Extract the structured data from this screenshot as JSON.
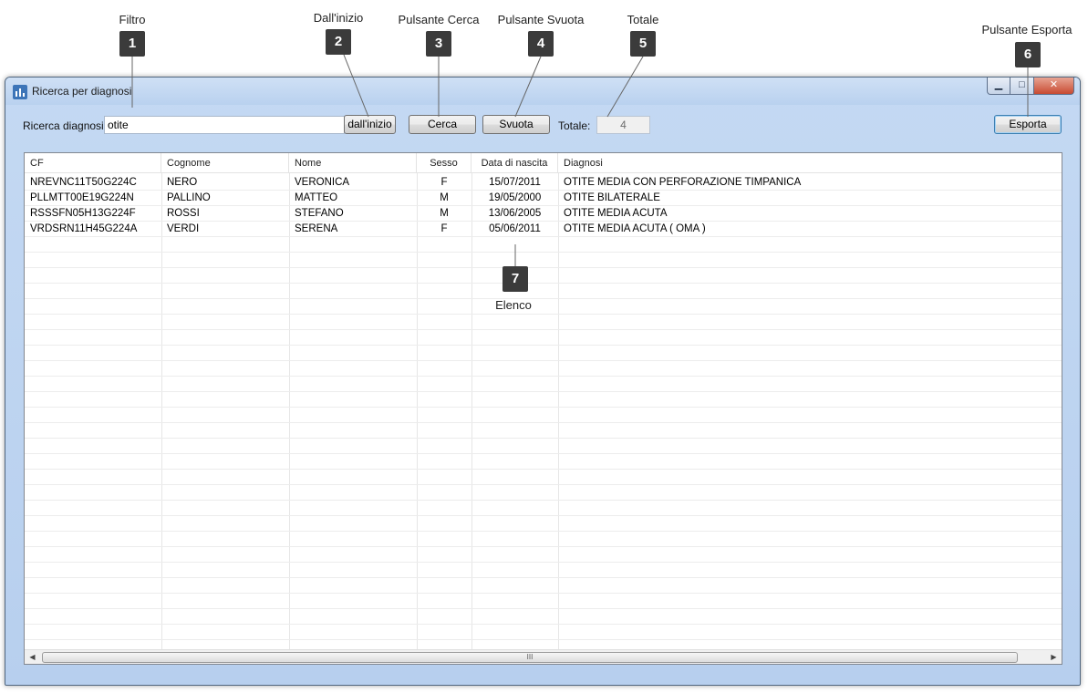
{
  "annotations": [
    {
      "num": "1",
      "label": "Filtro"
    },
    {
      "num": "2",
      "label": "Dall'inizio"
    },
    {
      "num": "3",
      "label": "Pulsante Cerca"
    },
    {
      "num": "4",
      "label": "Pulsante Svuota"
    },
    {
      "num": "5",
      "label": "Totale"
    },
    {
      "num": "6",
      "label": "Pulsante Esporta"
    },
    {
      "num": "7",
      "label": "Elenco"
    }
  ],
  "window": {
    "title": "Ricerca per diagnosi",
    "icon": "bar-chart-icon",
    "controls": {
      "minimize": "▁",
      "maximize": "□",
      "close": "✕"
    }
  },
  "toolbar": {
    "search_label": "Ricerca diagnosi",
    "search_value": "otite",
    "from_start_label": "dall'inizio",
    "search_button": "Cerca",
    "clear_button": "Svuota",
    "total_label": "Totale:",
    "total_value": "4",
    "export_button": "Esporta"
  },
  "grid": {
    "columns": [
      "CF",
      "Cognome",
      "Nome",
      "Sesso",
      "Data di nascita",
      "Diagnosi"
    ],
    "rows": [
      [
        "NREVNC11T50G224C",
        "NERO",
        "VERONICA",
        "F",
        "15/07/2011",
        "OTITE MEDIA CON PERFORAZIONE TIMPANICA"
      ],
      [
        "PLLMTT00E19G224N",
        "PALLINO",
        "MATTEO",
        "M",
        "19/05/2000",
        "OTITE BILATERALE"
      ],
      [
        "RSSSFN05H13G224F",
        "ROSSI",
        "STEFANO",
        "M",
        "13/06/2005",
        "OTITE MEDIA ACUTA"
      ],
      [
        "VRDSRN11H45G224A",
        "VERDI",
        "SERENA",
        "F",
        "05/06/2011",
        "OTITE MEDIA ACUTA ( OMA )"
      ]
    ],
    "scroll_left": "◀",
    "scroll_right": "▶",
    "scroll_grip": "III"
  }
}
